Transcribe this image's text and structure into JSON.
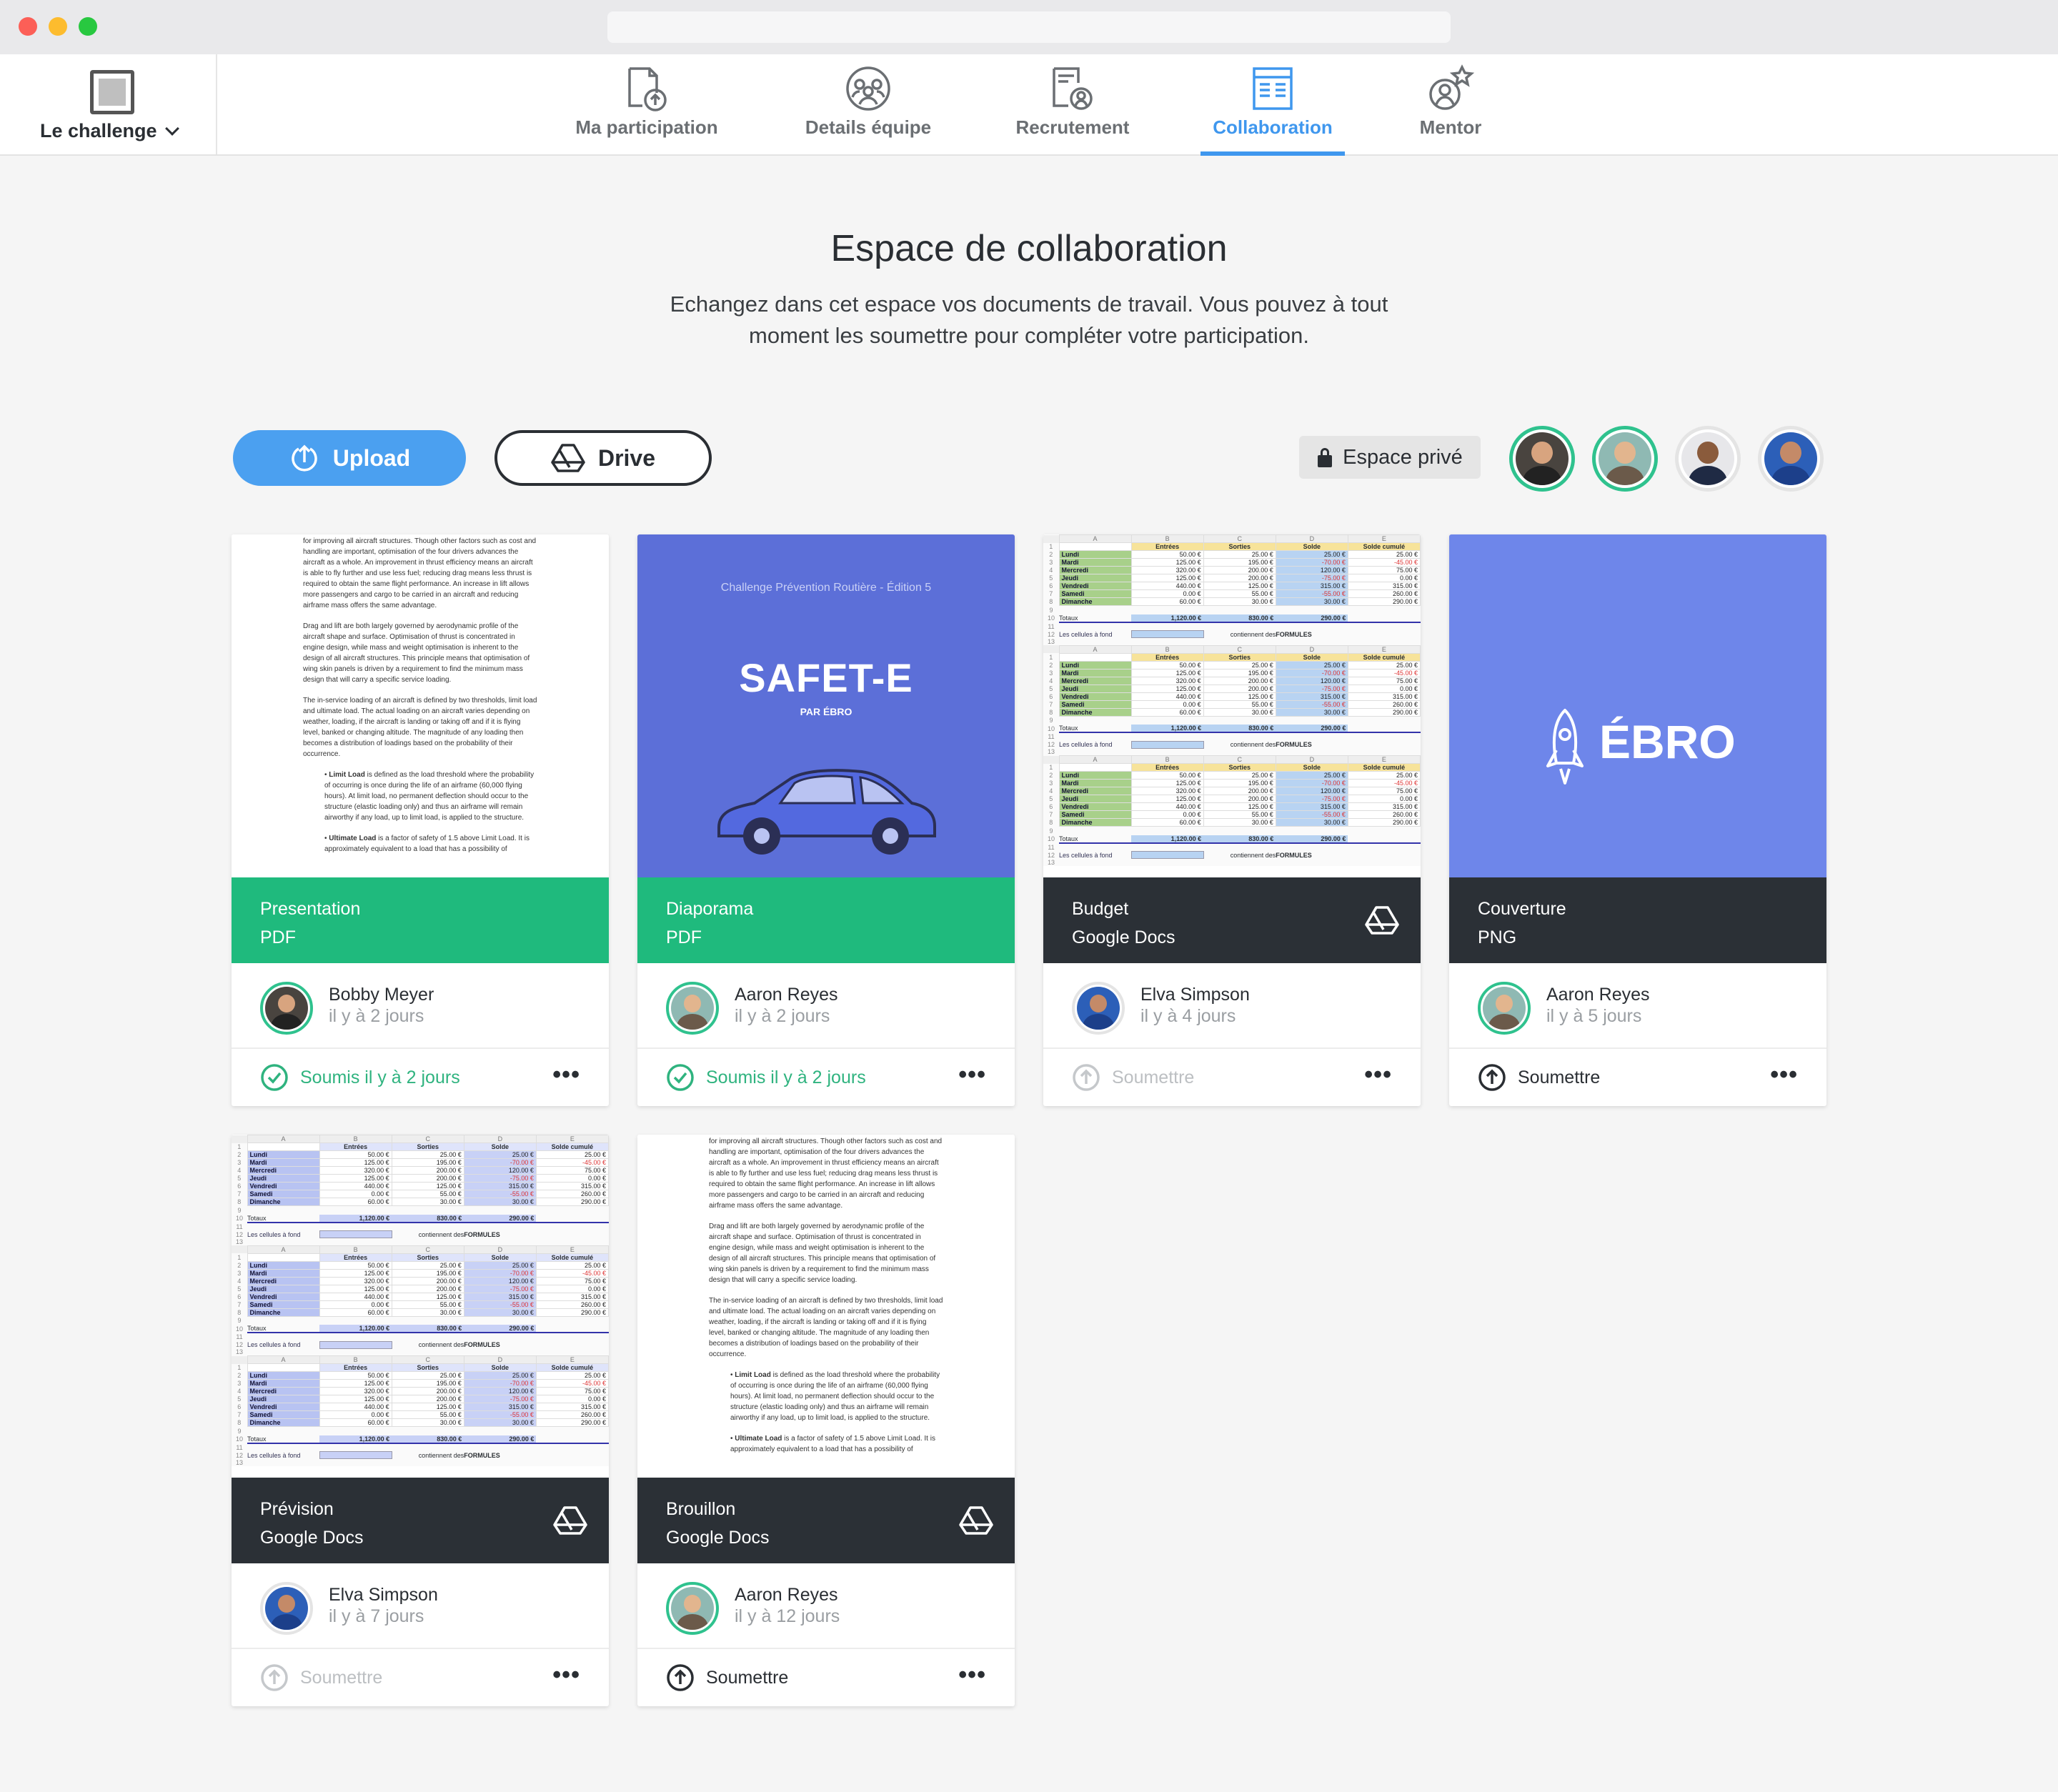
{
  "nav": {
    "challenge_label": "Le challenge",
    "tabs": [
      {
        "label": "Ma participation",
        "icon": "document-upload-icon"
      },
      {
        "label": "Details équipe",
        "icon": "team-icon"
      },
      {
        "label": "Recrutement",
        "icon": "recruitment-icon"
      },
      {
        "label": "Collaboration",
        "icon": "collaboration-icon",
        "active": true
      },
      {
        "label": "Mentor",
        "icon": "mentor-icon"
      }
    ]
  },
  "header": {
    "title": "Espace de collaboration",
    "description": "Echangez dans cet espace vos documents de travail. Vous pouvez à tout moment les soumettre pour compléter votre participation."
  },
  "toolbar": {
    "upload_label": "Upload",
    "drive_label": "Drive",
    "privacy_label": "Espace privé"
  },
  "colors": {
    "accent": "#3f97ee",
    "green": "#2fc28e",
    "dark": "#2b3036",
    "slide_blue": "#5c6fd8",
    "cover_blue": "#6e86ea"
  },
  "cards": [
    {
      "title": "Presentation",
      "type": "PDF",
      "author": "Bobby Meyer",
      "time": "il y à 2 jours",
      "action": "Soumis il y à 2 jours",
      "status": "submitted"
    },
    {
      "title": "Diaporama",
      "type": "PDF",
      "author": "Aaron Reyes",
      "time": "il y à 2 jours",
      "action": "Soumis il y à 2 jours",
      "status": "submitted"
    },
    {
      "title": "Budget",
      "type": "Google Docs",
      "author": "Elva Simpson",
      "time": "il y à 4 jours",
      "action": "Soumettre",
      "status": "disabled"
    },
    {
      "title": "Couverture",
      "type": "PNG",
      "author": "Aaron Reyes",
      "time": "il y à 5 jours",
      "action": "Soumettre",
      "status": "ready"
    },
    {
      "title": "Prévision",
      "type": "Google Docs",
      "author": "Elva Simpson",
      "time": "il y à 7 jours",
      "action": "Soumettre",
      "status": "disabled"
    },
    {
      "title": "Brouillon",
      "type": "Google Docs",
      "author": "Aaron Reyes",
      "time": "il y à 12 jours",
      "action": "Soumettre",
      "status": "ready"
    }
  ],
  "more_label": "•••",
  "slide": {
    "subtitle": "Challenge Prévention Routière - Édition 5",
    "title": "SAFET-E",
    "byline": "PAR ÉBRO"
  },
  "cover": {
    "brand": "ÉBRO"
  },
  "doc_preview": {
    "p1": "for improving all aircraft structures. Though other factors such as cost and handling are important, optimisation of the four drivers advances the aircraft as a whole. An improvement in thrust efficiency means an aircraft is able to fly further and use less fuel; reducing drag means less thrust is required to obtain the same flight performance. An increase in lift allows more passengers and cargo to be carried in an aircraft and reducing airframe mass offers the same advantage.",
    "p2": "Drag and lift are both largely governed by aerodynamic profile of the aircraft shape and surface. Optimisation of thrust is concentrated in engine design, while mass and weight optimisation is inherent to the design of all aircraft structures. This principle means that optimisation of wing skin panels is driven by a requirement to find the minimum mass design that will carry a specific service loading.",
    "p3": "The in-service loading of an aircraft is defined by two thresholds, limit load and ultimate load. The actual loading on an aircraft varies depending on weather, loading, if the aircraft is landing or taking off and if it is flying level, banked or changing altitude. The magnitude of any loading then becomes a distribution of loadings based on the probability of their occurrence.",
    "b1_title": "Limit Load",
    "b1": " is defined as the load threshold where the probability of occurring is once during the life of an airframe (60,000 flying hours). At limit load, no permanent deflection should occur to the structure (elastic loading only) and thus an airframe will remain airworthy if any load, up to limit load, is applied to the structure.",
    "b2_title": "Ultimate Load",
    "b2": " is a factor of safety of 1.5 above Limit Load. It is approximately equivalent to a load that has a possibility of"
  },
  "sheet_preview": {
    "columns": [
      "A",
      "B",
      "C",
      "D",
      "E"
    ],
    "headers": [
      "",
      "Entrées",
      "Sorties",
      "Solde",
      "Solde cumulé"
    ],
    "rows": [
      [
        "Lundi",
        "50.00 €",
        "25.00 €",
        "25.00 €",
        "25.00 €"
      ],
      [
        "Mardi",
        "125.00 €",
        "195.00 €",
        "-70.00 €",
        "-45.00 €"
      ],
      [
        "Mercredi",
        "320.00 €",
        "200.00 €",
        "120.00 €",
        "75.00 €"
      ],
      [
        "Jeudi",
        "125.00 €",
        "200.00 €",
        "-75.00 €",
        "0.00 €"
      ],
      [
        "Vendredi",
        "440.00 €",
        "125.00 €",
        "315.00 €",
        "315.00 €"
      ],
      [
        "Samedi",
        "0.00 €",
        "55.00 €",
        "-55.00 €",
        "260.00 €"
      ],
      [
        "Dimanche",
        "60.00 €",
        "30.00 €",
        "30.00 €",
        "290.00 €"
      ]
    ],
    "total_label": "Totaux",
    "totals": [
      "1,120.00 €",
      "830.00 €",
      "290.00 €"
    ],
    "note_left": "Les cellules à fond",
    "note_mid": "contiennent des",
    "note_right": "FORMULES"
  }
}
